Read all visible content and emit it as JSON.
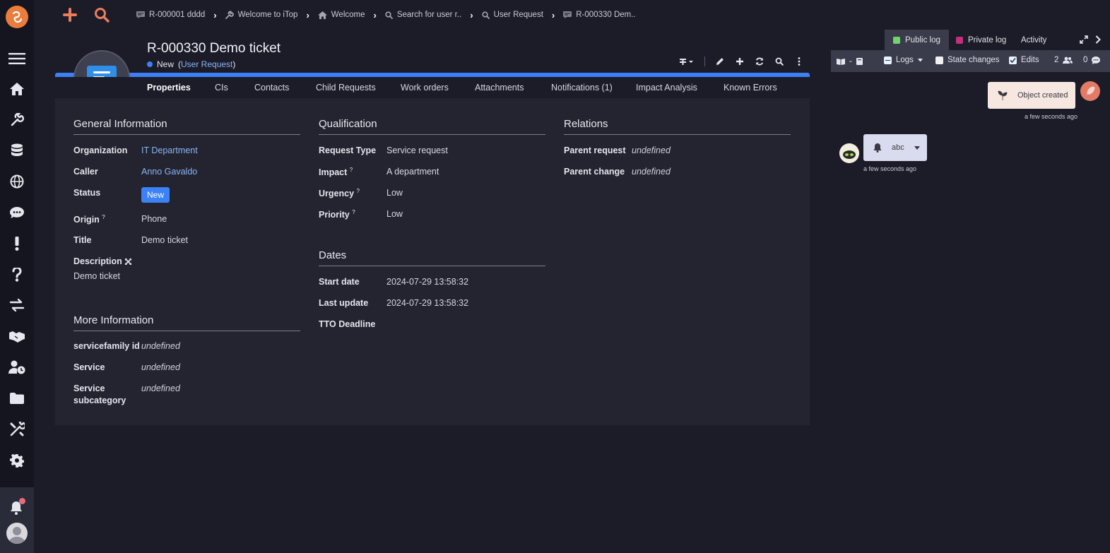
{
  "nav": {
    "items": [
      "menu-icon",
      "home-icon",
      "wrench-icon",
      "database-icon",
      "globe-icon",
      "chat-icon",
      "exclamation-icon",
      "question-icon",
      "exchange-icon",
      "handshake-icon",
      "user-clock-icon",
      "folder-icon",
      "tools-icon",
      "gear-icon"
    ],
    "notifications_icon": "bell-icon"
  },
  "topbar": {
    "quick_create_icon": "plus-icon",
    "global_search_icon": "search-icon",
    "breadcrumbs": [
      {
        "label": "R-000001 dddd",
        "icon": "ticket-icon"
      },
      {
        "label": "Welcome to iTop",
        "icon": "wrench-icon"
      },
      {
        "label": "Welcome",
        "icon": "home-icon"
      },
      {
        "label": "Search for user r..",
        "icon": "search-icon"
      },
      {
        "label": "User Request",
        "icon": "search-icon"
      },
      {
        "label": "R-000330 Dem..",
        "icon": "ticket-icon"
      }
    ]
  },
  "object": {
    "title": "R-000330 Demo ticket",
    "status": "New",
    "class_prefix": "(",
    "class_name": "User Request",
    "class_suffix": ")",
    "accent_color": "#3d7ff4"
  },
  "tabs": [
    "Properties",
    "CIs",
    "Contacts",
    "Child Requests",
    "Work orders",
    "Attachments",
    "Notifications (1)",
    "Impact Analysis",
    "Known Errors"
  ],
  "sections": {
    "general": {
      "title": "General Information",
      "organization_label": "Organization",
      "organization_value": "IT Department",
      "caller_label": "Caller",
      "caller_value": "Anno Gavaldo",
      "status_label": "Status",
      "status_value": "New",
      "origin_label": "Origin",
      "origin_value": "Phone",
      "title_label": "Title",
      "title_value": "Demo ticket",
      "description_label": "Description",
      "description_value": "Demo ticket"
    },
    "more": {
      "title": "More Information",
      "servicefamily_label": "servicefamily id",
      "servicefamily_value": "undefined",
      "service_label": "Service",
      "service_value": "undefined",
      "subcategory_label_1": "Service",
      "subcategory_label_2": "subcategory",
      "subcategory_value": "undefined"
    },
    "qualification": {
      "title": "Qualification",
      "request_type_label": "Request Type",
      "request_type_value": "Service request",
      "impact_label": "Impact",
      "impact_value": "A department",
      "urgency_label": "Urgency",
      "urgency_value": "Low",
      "priority_label": "Priority",
      "priority_value": "Low"
    },
    "dates": {
      "title": "Dates",
      "start_label": "Start date",
      "start_value": "2024-07-29 13:58:32",
      "update_label": "Last update",
      "update_value": "2024-07-29 13:58:32",
      "tto_label": "TTO Deadline"
    },
    "relations": {
      "title": "Relations",
      "parent_request_label": "Parent request",
      "parent_request_value": "undefined",
      "parent_change_label": "Parent change",
      "parent_change_value": "undefined"
    }
  },
  "activity": {
    "tabs": [
      {
        "label": "Public log",
        "color": "#6fd46f"
      },
      {
        "label": "Private log",
        "color": "#c2307a"
      },
      {
        "label": "Activity",
        "color": ""
      }
    ],
    "toolbar": {
      "logs_label": "Logs",
      "state_changes_label": "State changes",
      "edits_label": "Edits",
      "participants_count": "2",
      "messages_count": "0"
    },
    "entries": [
      {
        "text": "Object created",
        "time": "a few seconds ago"
      },
      {
        "text": "abc",
        "time": "a few seconds ago"
      }
    ]
  }
}
